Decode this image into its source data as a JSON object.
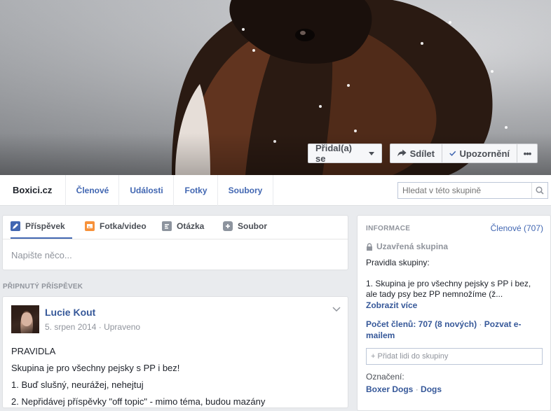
{
  "cover": {
    "join_button": "Přidal(a) se",
    "share_button": "Sdílet",
    "notifications_button": "Upozornění",
    "more_button": "•••"
  },
  "nav": {
    "group_name": "Boxici.cz",
    "tabs": [
      "Členové",
      "Události",
      "Fotky",
      "Soubory"
    ],
    "search_placeholder": "Hledat v této skupině"
  },
  "composer": {
    "tabs": [
      {
        "label": "Příspěvek",
        "icon": "pencil-icon"
      },
      {
        "label": "Fotka/video",
        "icon": "photo-icon"
      },
      {
        "label": "Otázka",
        "icon": "poll-icon"
      },
      {
        "label": "Soubor",
        "icon": "file-plus-icon"
      }
    ],
    "placeholder": "Napište něco..."
  },
  "pinned_label": "PŘIPNUTÝ PŘÍSPĚVEK",
  "post": {
    "author": "Lucie Kout",
    "date": "5. srpen 2014",
    "edited": "Upraveno",
    "lines": [
      "PRAVIDLA",
      "Skupina je pro všechny pejsky s PP i bez!",
      "1. Buď slušný, neurážej, nehejtuj",
      "2. Nepřidávej příspěvky \"off topic\" - mimo téma, budou mazány"
    ]
  },
  "info": {
    "heading": "INFORMACE",
    "members_link": "Členové (707)",
    "closed_group": "Uzavřená skupina",
    "rules_label": "Pravidla skupiny:",
    "rules_text": "1. Skupina je pro všechny pejsky s PP i bez, ale tady psy bez PP nemnožíme (ž...",
    "show_more": "Zobrazit více",
    "member_count": "Počet členů: 707",
    "new_count": "(8 nových)",
    "invite_email": "Pozvat e-mailem",
    "add_people_placeholder": "+ Přidat lidi do skupiny",
    "tags_heading": "Označení:",
    "tags": [
      "Boxer Dogs",
      "Dogs"
    ]
  },
  "colors": {
    "link": "#365899",
    "accent": "#4267b2",
    "muted": "#90949c",
    "background": "#e9ebee"
  }
}
